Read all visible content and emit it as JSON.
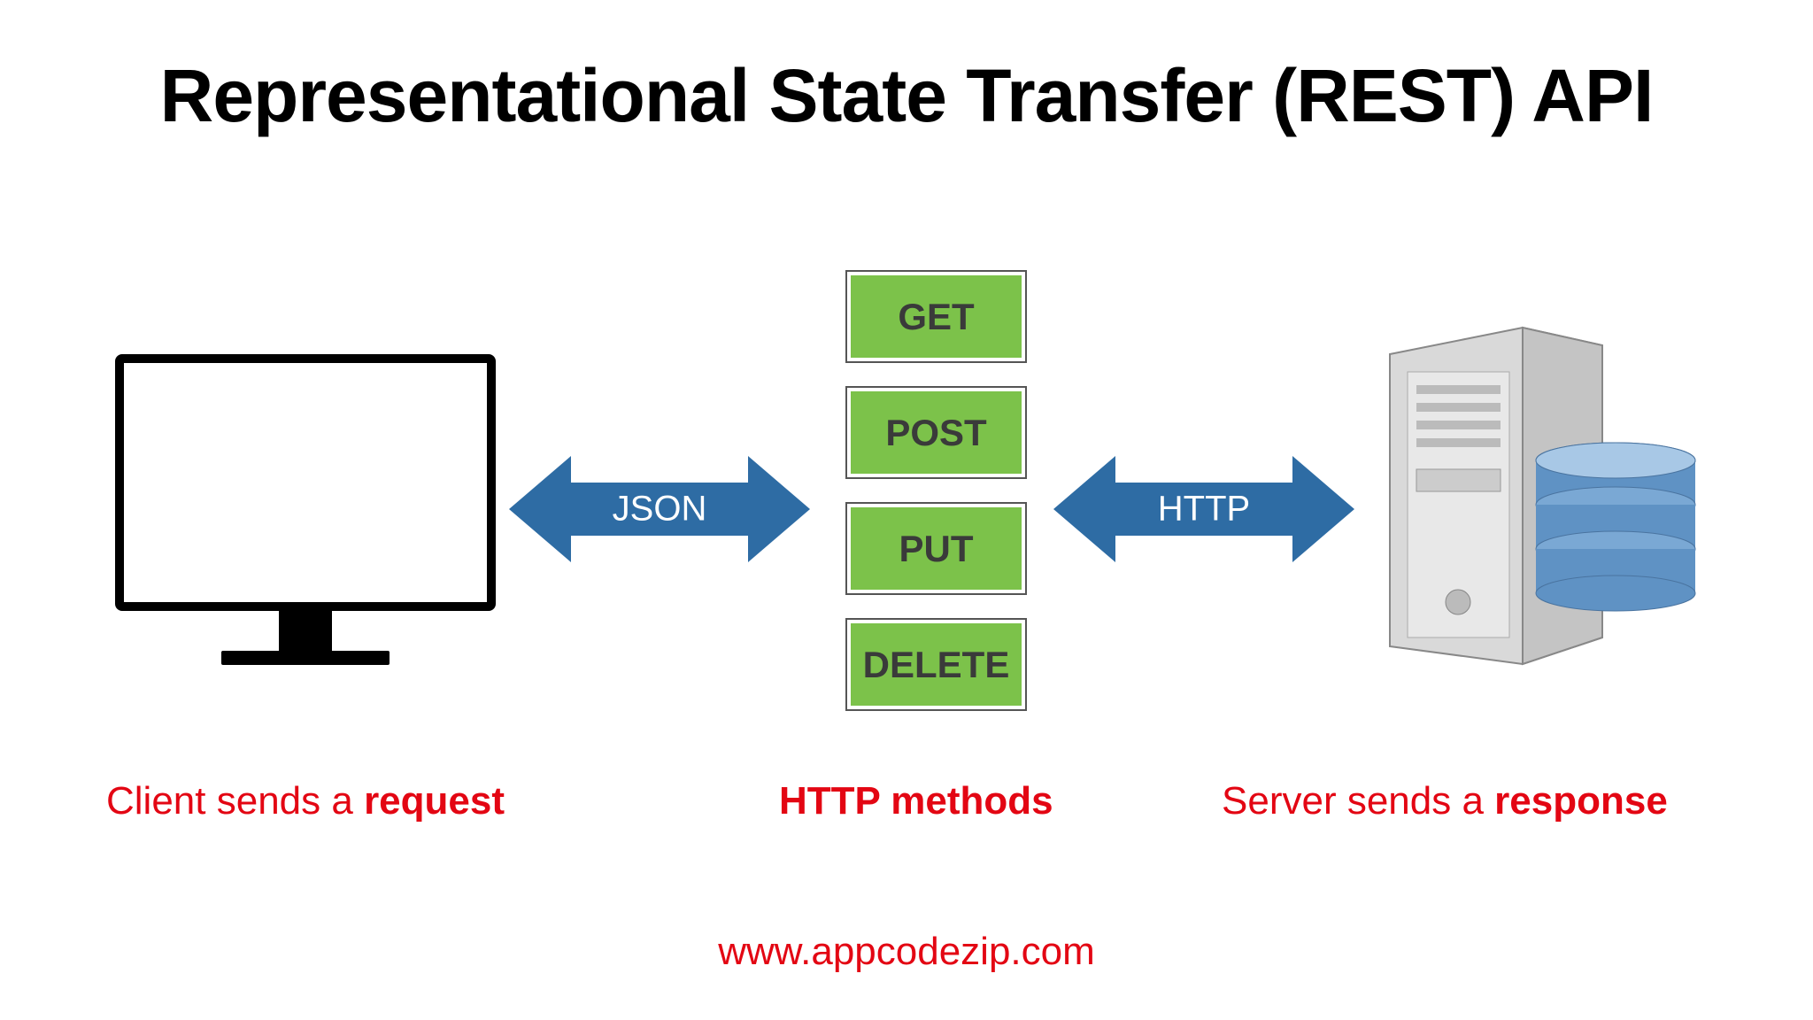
{
  "title": "Representational State Transfer (REST) API",
  "arrows": {
    "json_label": "JSON",
    "http_label": "HTTP"
  },
  "methods": [
    "GET",
    "POST",
    "PUT",
    "DELETE"
  ],
  "captions": {
    "client_prefix": "Client sends a ",
    "client_bold": "request",
    "methods": "HTTP methods",
    "server_prefix": "Server sends a ",
    "server_bold": "response"
  },
  "footer_url": "www.appcodezip.com"
}
